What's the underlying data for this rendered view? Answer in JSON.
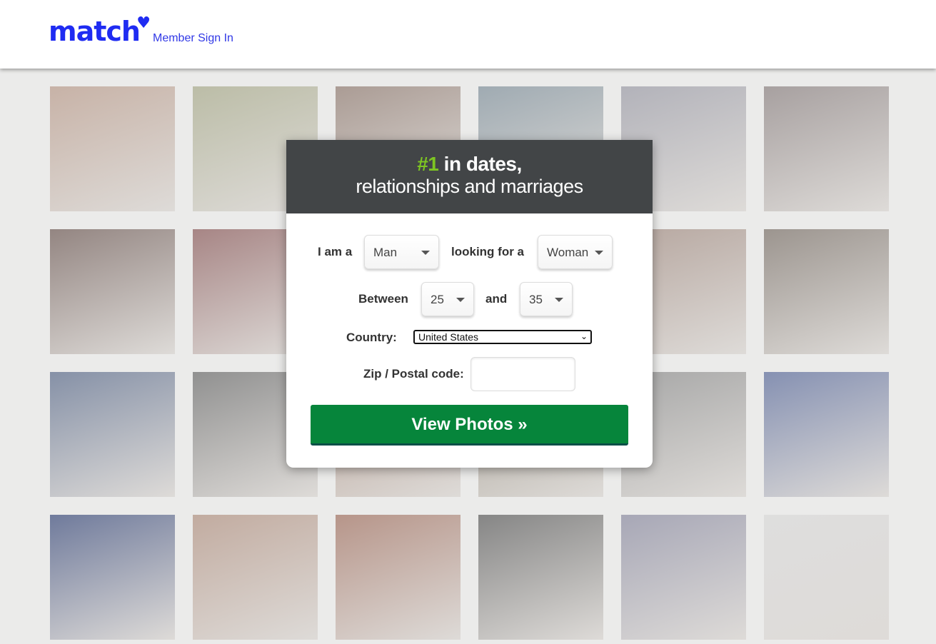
{
  "header": {
    "logo_text": "match",
    "sign_in": "Member Sign In"
  },
  "modal": {
    "headline_num": "#1",
    "headline_rest": " in dates,",
    "subheadline": "relationships and marriages",
    "i_am_label": "I am a",
    "i_am_value": "Man",
    "looking_label": "looking for a",
    "looking_value": "Woman",
    "between_label": "Between",
    "age_min": "25",
    "and_label": "and",
    "age_max": "35",
    "country_label": "Country:",
    "country_value": "United States",
    "zip_label": "Zip / Postal code:",
    "zip_value": "",
    "submit": "View Photos »"
  },
  "colors": {
    "brand": "#1f2cf2",
    "accent_green": "#7dc522",
    "button": "#06853b",
    "modal_header": "#424547"
  }
}
